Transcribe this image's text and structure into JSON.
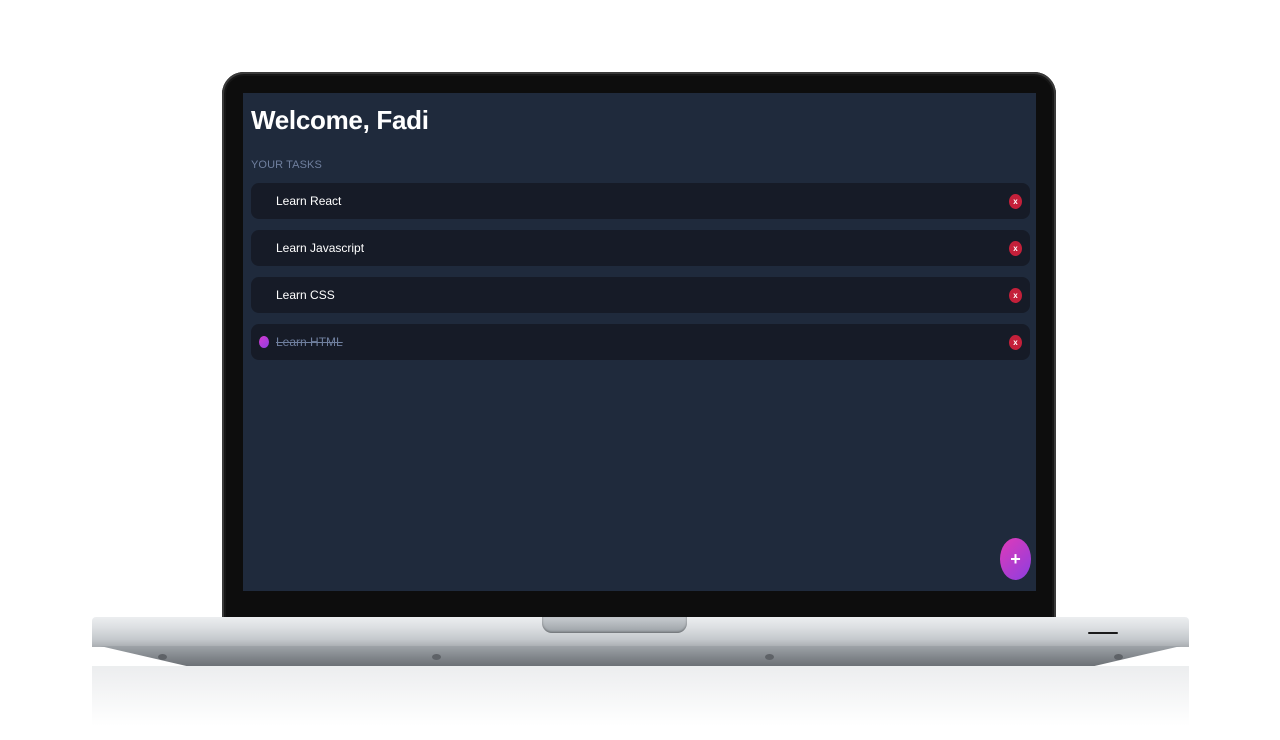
{
  "header": {
    "title": "Welcome, Fadi"
  },
  "tasks_section": {
    "label": "YOUR TASKS",
    "items": [
      {
        "text": "Learn React",
        "completed": false,
        "delete_label": "x"
      },
      {
        "text": "Learn Javascript",
        "completed": false,
        "delete_label": "x"
      },
      {
        "text": "Learn CSS",
        "completed": false,
        "delete_label": "x"
      },
      {
        "text": "Learn HTML",
        "completed": true,
        "delete_label": "x"
      }
    ]
  },
  "fab": {
    "label": "+"
  },
  "colors": {
    "background": "#1f2a3c",
    "task_background": "#161b27",
    "delete_red": "#c4203a",
    "accent_gradient_start": "#e03ab8",
    "accent_gradient_end": "#8c3ee0",
    "muted_text": "#6f7f9e"
  },
  "icons": {
    "delete": "close-icon",
    "add": "plus-icon",
    "completed_marker": "check-dot-icon"
  }
}
